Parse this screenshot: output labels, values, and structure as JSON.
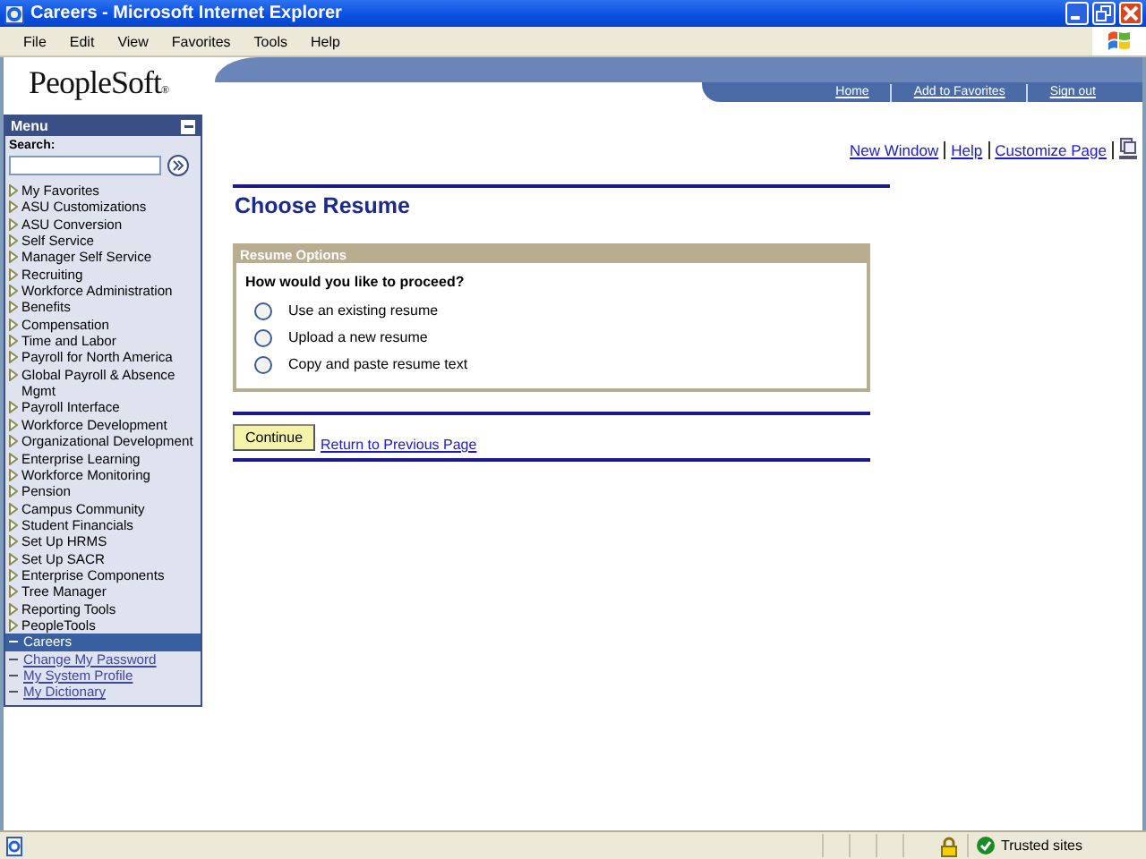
{
  "window": {
    "title": "Careers - Microsoft Internet Explorer"
  },
  "menu_bar": [
    "File",
    "Edit",
    "View",
    "Favorites",
    "Tools",
    "Help"
  ],
  "header": {
    "logo": "PeopleSoft",
    "logo_mark": "®",
    "links": [
      "Home",
      "Add to Favorites",
      "Sign out"
    ]
  },
  "page_links": [
    "New Window",
    "Help",
    "Customize Page"
  ],
  "sidebar": {
    "title": "Menu",
    "search_label": "Search:",
    "items": [
      {
        "label": "My Favorites",
        "kind": "folder",
        "selected": false
      },
      {
        "label": "ASU Customizations",
        "kind": "folder",
        "selected": false
      },
      {
        "label": "ASU Conversion",
        "kind": "folder",
        "selected": false
      },
      {
        "label": "Self Service",
        "kind": "folder",
        "selected": false
      },
      {
        "label": "Manager Self Service",
        "kind": "folder",
        "selected": false
      },
      {
        "label": "Recruiting",
        "kind": "folder",
        "selected": false
      },
      {
        "label": "Workforce Administration",
        "kind": "folder",
        "selected": false
      },
      {
        "label": "Benefits",
        "kind": "folder",
        "selected": false
      },
      {
        "label": "Compensation",
        "kind": "folder",
        "selected": false
      },
      {
        "label": "Time and Labor",
        "kind": "folder",
        "selected": false
      },
      {
        "label": "Payroll for North America",
        "kind": "folder",
        "selected": false
      },
      {
        "label": "Global Payroll & Absence Mgmt",
        "kind": "folder",
        "selected": false
      },
      {
        "label": "Payroll Interface",
        "kind": "folder",
        "selected": false
      },
      {
        "label": "Workforce Development",
        "kind": "folder",
        "selected": false
      },
      {
        "label": "Organizational Development",
        "kind": "folder",
        "selected": false
      },
      {
        "label": "Enterprise Learning",
        "kind": "folder",
        "selected": false
      },
      {
        "label": "Workforce Monitoring",
        "kind": "folder",
        "selected": false
      },
      {
        "label": "Pension",
        "kind": "folder",
        "selected": false
      },
      {
        "label": "Campus Community",
        "kind": "folder",
        "selected": false
      },
      {
        "label": "Student Financials",
        "kind": "folder",
        "selected": false
      },
      {
        "label": "Set Up HRMS",
        "kind": "folder",
        "selected": false
      },
      {
        "label": "Set Up SACR",
        "kind": "folder",
        "selected": false
      },
      {
        "label": "Enterprise Components",
        "kind": "folder",
        "selected": false
      },
      {
        "label": "Tree Manager",
        "kind": "folder",
        "selected": false
      },
      {
        "label": "Reporting Tools",
        "kind": "folder",
        "selected": false
      },
      {
        "label": "PeopleTools",
        "kind": "folder",
        "selected": false
      },
      {
        "label": "Careers",
        "kind": "page",
        "selected": true
      },
      {
        "label": "Change My Password",
        "kind": "page",
        "selected": false
      },
      {
        "label": "My System Profile",
        "kind": "page",
        "selected": false
      },
      {
        "label": "My Dictionary",
        "kind": "page",
        "selected": false
      }
    ]
  },
  "page": {
    "title": "Choose Resume",
    "group_title": "Resume Options",
    "question": "How would you like to proceed?",
    "options": [
      {
        "label": "Use an existing resume",
        "selected": false
      },
      {
        "label": "Upload a new resume",
        "selected": false
      },
      {
        "label": "Copy and paste resume text",
        "selected": false
      }
    ],
    "continue_button": "Continue",
    "return_link": "Return to Previous Page"
  },
  "status_bar": {
    "zone": "Trusted sites"
  }
}
